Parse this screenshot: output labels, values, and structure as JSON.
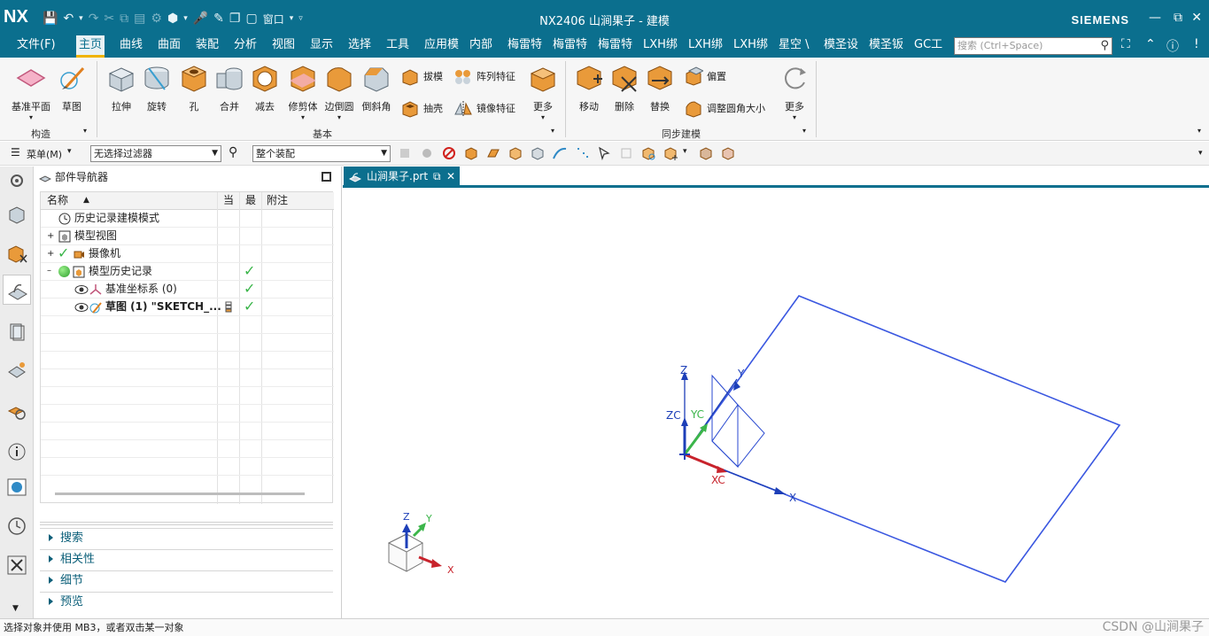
{
  "app": {
    "logo": "NX",
    "title": "NX2406 山涧果子 - 建模",
    "brand": "SIEMENS",
    "window_menu": "窗口"
  },
  "menu": {
    "tabs": [
      "文件(F)",
      "主页",
      "曲线",
      "曲面",
      "装配",
      "分析",
      "视图",
      "显示",
      "选择",
      "工具",
      "应用模",
      "内部",
      "梅雷特",
      "梅雷特",
      "梅雷特",
      "LXH绑",
      "LXH绑",
      "LXH绑",
      "星空 \\",
      "模圣设",
      "模圣钣",
      "GC工"
    ],
    "search_placeholder": "搜索 (Ctrl+Space)"
  },
  "ribbon": {
    "group1": {
      "label": "构造",
      "items": [
        "基准平面",
        "草图"
      ]
    },
    "group2": {
      "label": "基本",
      "items": [
        "拉伸",
        "旋转",
        "孔",
        "合并",
        "减去",
        "修剪体",
        "边倒圆",
        "倒斜角"
      ],
      "small": [
        "拔模",
        "阵列特征",
        "抽壳",
        "镜像特征"
      ],
      "more": "更多"
    },
    "group3": {
      "label": "同步建模",
      "items": [
        "移动",
        "删除",
        "替换"
      ],
      "small": [
        "偏置",
        "调整圆角大小"
      ],
      "more": "更多"
    }
  },
  "filterbar": {
    "menu_label": "菜单(M)",
    "filter_value": "无选择过滤器",
    "scope_value": "整个装配"
  },
  "navigator": {
    "title": "部件导航器",
    "columns": [
      "名称",
      "当",
      "最",
      "附注"
    ],
    "rows": [
      {
        "label": "历史记录建模模式",
        "checked": false
      },
      {
        "label": "模型视图",
        "checked": false
      },
      {
        "label": "摄像机",
        "checked": false
      },
      {
        "label": "模型历史记录",
        "checked": true
      },
      {
        "label": "基准坐标系 (0)",
        "checked": true
      },
      {
        "label": "草图 (1) \"SKETCH_...",
        "checked": true
      }
    ],
    "panels": [
      "搜索",
      "相关性",
      "细节",
      "预览"
    ]
  },
  "document": {
    "tab_label": "山涧果子.prt"
  },
  "viewport": {
    "axis_labels": {
      "z": "Z",
      "y": "Y",
      "x": "X",
      "zc": "ZC",
      "yc": "YC",
      "xc": "XC"
    },
    "triad_labels": {
      "z": "Z",
      "y": "Y",
      "x": "X"
    },
    "colors": {
      "sketch": "#3a57e0",
      "xc": "#c8232c",
      "yc": "#3bb54a",
      "zc": "#1d3fb8"
    }
  },
  "status": {
    "message": "选择对象并使用 MB3，或者双击某一对象",
    "watermark": "CSDN @山涧果子"
  }
}
